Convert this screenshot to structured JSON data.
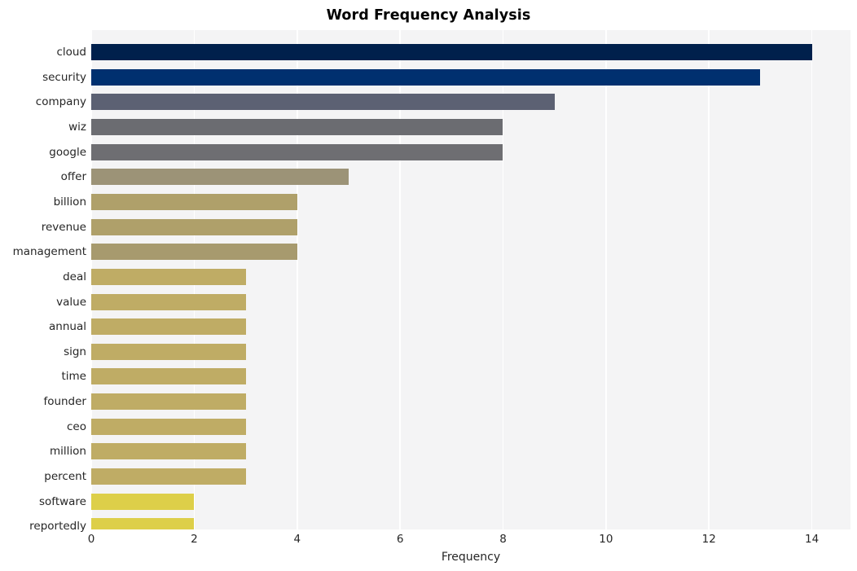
{
  "chart_data": {
    "type": "bar",
    "orientation": "horizontal",
    "title": "Word Frequency Analysis",
    "xlabel": "Frequency",
    "ylabel": "",
    "categories": [
      "cloud",
      "security",
      "company",
      "wiz",
      "google",
      "offer",
      "billion",
      "revenue",
      "management",
      "deal",
      "value",
      "annual",
      "sign",
      "time",
      "founder",
      "ceo",
      "million",
      "percent",
      "software",
      "reportedly"
    ],
    "values": [
      14,
      13,
      9,
      8,
      8,
      5,
      4,
      4,
      4,
      3,
      3,
      3,
      3,
      3,
      3,
      3,
      3,
      3,
      2,
      2
    ],
    "bar_colors": [
      "#00204c",
      "#00306f",
      "#5c6173",
      "#6b6c71",
      "#6e6e72",
      "#9c9377",
      "#afa06a",
      "#afa06a",
      "#a79a6e",
      "#bfac65",
      "#bfac65",
      "#bfac65",
      "#bfac65",
      "#bfac65",
      "#bfac65",
      "#bfac65",
      "#bfac65",
      "#bfac65",
      "#ddcf49",
      "#ddcf49"
    ],
    "xticks": [
      0,
      2,
      4,
      6,
      8,
      10,
      12,
      14
    ],
    "xtick_labels": [
      "0",
      "2",
      "4",
      "6",
      "8",
      "10",
      "12",
      "14"
    ],
    "xlim": [
      0,
      14.75
    ],
    "grid": "vertical-white",
    "legend": null,
    "style": {
      "plot_background": "#f4f4f5",
      "figure_background": "#ffffff",
      "gridline_color": "#ffffff",
      "tick_label_color": "#262626",
      "title_color": "#000000",
      "colormap": "cividis"
    }
  }
}
